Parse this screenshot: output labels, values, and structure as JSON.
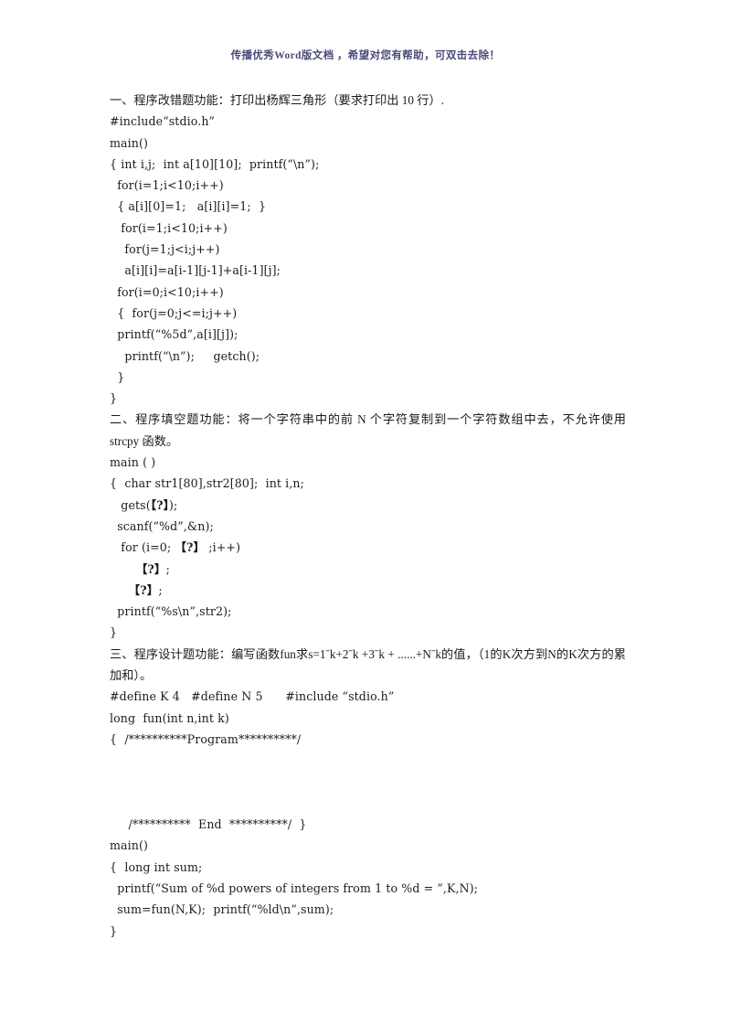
{
  "header": {
    "watermark": "传播优秀Word版文档 ，希望对您有帮助，可双击去除！",
    "color": "#4a4a78"
  },
  "document": {
    "sections": [
      {
        "id": "section-1",
        "heading": "一、程序改错题功能：打印出杨辉三角形（要求打印出 10 行）.",
        "code": [
          "#include“stdio.h”",
          "main()",
          "{ int i,j;  int a[10][10];  printf(“\\n”);",
          "  for(i=1;i<10;i++)",
          "  { a[i][0]=1;   a[i][i]=1;  }",
          "   for(i=1;i<10;i++)",
          "    for(j=1;j<i;j++)",
          "    a[i][i]=a[i-1][j-1]+a[i-1][j];",
          "  for(i=0;i<10;i++)",
          "  {  for(j=0;j<=i;j++)",
          "  printf(“%5d”,a[i][j]);",
          "    printf(“\\n”);     getch();",
          "  }",
          "}"
        ]
      },
      {
        "id": "section-2",
        "heading": "二、程序填空题功能：将一个字符串中的前 N 个字符复制到一个字符数组中去，不允许使用 strcpy 函数。",
        "code": [
          "main ( )",
          "{  char str1[80],str2[80];  int i,n;",
          "   gets(【?】);",
          "  scanf(“%d”,&n);",
          "   for (i=0; 【?】 ;i++)",
          "       【?】;",
          "     【?】;",
          "  printf(“%s\\n”,str2);",
          "}"
        ]
      },
      {
        "id": "section-3",
        "heading": "三、程序设计题功能：编写函数fun求s=1ˉk+2ˉk +3ˉk + ......+Nˉk的值，（1的K次方到N的K次方的累加和）。",
        "code": [
          "#define K 4   #define N 5      #include “stdio.h”",
          "long  fun(int n,int k)",
          "{  /**********Program**********/",
          "",
          "",
          "",
          "     /**********  End  **********/  }",
          "main()",
          "{  long int sum;",
          "  printf(“Sum of %d powers of integers from 1 to %d = ”,K,N);",
          "  sum=fun(N,K);  printf(“%ld\\n”,sum);",
          "}"
        ]
      }
    ]
  }
}
